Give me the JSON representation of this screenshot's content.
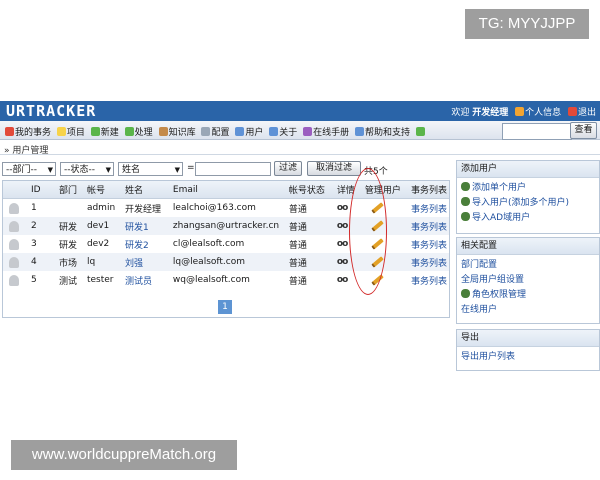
{
  "watermarks": {
    "top": "TG: MYYJJPP",
    "bottom": "www.worldcuppreMatch.org"
  },
  "header": {
    "logo": "URTRACKER",
    "welcome": "欢迎",
    "user": "开发经理",
    "personal_info": "个人信息",
    "logout": "退出"
  },
  "nav": {
    "items": [
      "我的事务",
      "项目",
      "新建",
      "处理",
      "知识库",
      "配置",
      "用户",
      "关于",
      "在线手册",
      "帮助和支持"
    ],
    "search_placeholder": "",
    "search_button": "查看"
  },
  "breadcrumb": "» 用户管理",
  "filter": {
    "dept": "--部门--",
    "status": "--状态--",
    "field": "姓名",
    "operator": "=",
    "value": "",
    "filter_button": "过滤",
    "cancel_button": "取消过滤",
    "total": "共5个"
  },
  "table": {
    "headers": [
      "",
      "ID",
      "部门",
      "帐号",
      "姓名",
      "Email",
      "帐号状态",
      "详情",
      "管理用户",
      "事务列表"
    ],
    "rows": [
      {
        "id": "1",
        "dept": "",
        "account": "admin",
        "name": "开发经理",
        "email": "lealchoi@163.com",
        "status": "普通",
        "details": "ô",
        "link": "事务列表"
      },
      {
        "id": "2",
        "dept": "研发",
        "account": "dev1",
        "name": "研发1",
        "email": "zhangsan@urtracker.cn",
        "status": "普通",
        "details": "ô",
        "link": "事务列表"
      },
      {
        "id": "3",
        "dept": "研发",
        "account": "dev2",
        "name": "研发2",
        "email": "cl@lealsoft.com",
        "status": "普通",
        "details": "ô",
        "link": "事务列表"
      },
      {
        "id": "4",
        "dept": "市场",
        "account": "lq",
        "name": "刘强",
        "email": "lq@lealsoft.com",
        "status": "普通",
        "details": "ô",
        "link": "事务列表"
      },
      {
        "id": "5",
        "dept": "测试",
        "account": "tester",
        "name": "测试员",
        "email": "wq@lealsoft.com",
        "status": "普通",
        "details": "ô",
        "link": "事务列表"
      }
    ],
    "page": "1"
  },
  "sidebar": {
    "add_user": {
      "title": "添加用户",
      "items": [
        "添加单个用户",
        "导入用户(添加多个用户)",
        "导入AD域用户"
      ]
    },
    "config": {
      "title": "相关配置",
      "items": [
        "部门配置",
        "全局用户组设置",
        "角色权限管理",
        "在线用户"
      ]
    },
    "export": {
      "title": "导出",
      "items": [
        "导出用户列表"
      ]
    }
  }
}
